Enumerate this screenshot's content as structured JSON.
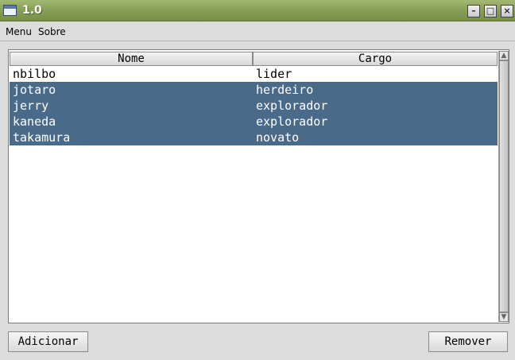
{
  "window": {
    "title": "1.0",
    "controls": {
      "minimize": "–",
      "maximize": "□",
      "close": "×"
    }
  },
  "menubar": {
    "items": [
      "Menu",
      "Sobre"
    ]
  },
  "table": {
    "columns": [
      "Nome",
      "Cargo"
    ],
    "rows": [
      {
        "nome": "nbilbo",
        "cargo": "lider",
        "selected": false
      },
      {
        "nome": "jotaro",
        "cargo": "herdeiro",
        "selected": true
      },
      {
        "nome": "jerry",
        "cargo": "explorador",
        "selected": true
      },
      {
        "nome": "kaneda",
        "cargo": "explorador",
        "selected": true
      },
      {
        "nome": "takamura",
        "cargo": "novato",
        "selected": true
      }
    ],
    "selection_color": "#4a6a8a"
  },
  "buttons": {
    "add_label": "Adicionar",
    "remove_label": "Remover"
  },
  "colors": {
    "titlebar": "#859c54",
    "background": "#dcdcdc"
  }
}
